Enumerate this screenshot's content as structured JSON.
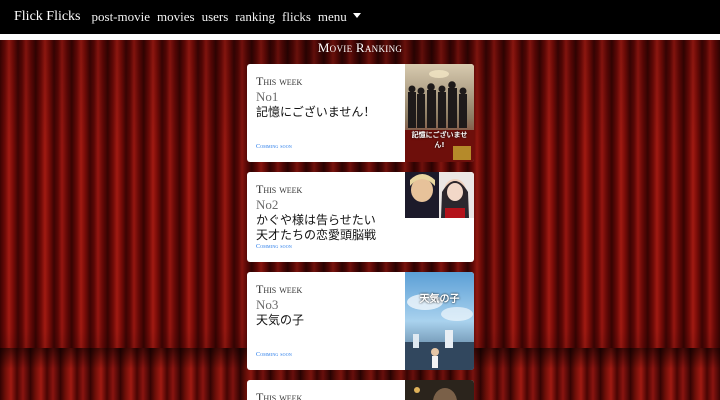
{
  "nav": {
    "brand": "Flick Flicks",
    "links": [
      "post-movie",
      "movies",
      "users",
      "ranking",
      "flicks",
      "menu"
    ]
  },
  "section_title": "Movie Ranking",
  "cards": [
    {
      "label": "This week",
      "rank": "No1",
      "title": "記憶にございません！",
      "soon": "Comming soon",
      "poster_text": "記憶にございません!"
    },
    {
      "label": "This week",
      "rank": "No2",
      "title": "かぐや様は告らせたい\n天才たちの恋愛頭脳戦",
      "soon": "Comming soon",
      "poster_text": ""
    },
    {
      "label": "This week",
      "rank": "No3",
      "title": "天気の子",
      "soon": "Comming soon",
      "poster_text": "天気の子"
    },
    {
      "label": "This week"
    }
  ],
  "colors": {
    "nav_bg": "#000000",
    "link": "#1a73e8",
    "curtain": "#8b0f0a"
  }
}
